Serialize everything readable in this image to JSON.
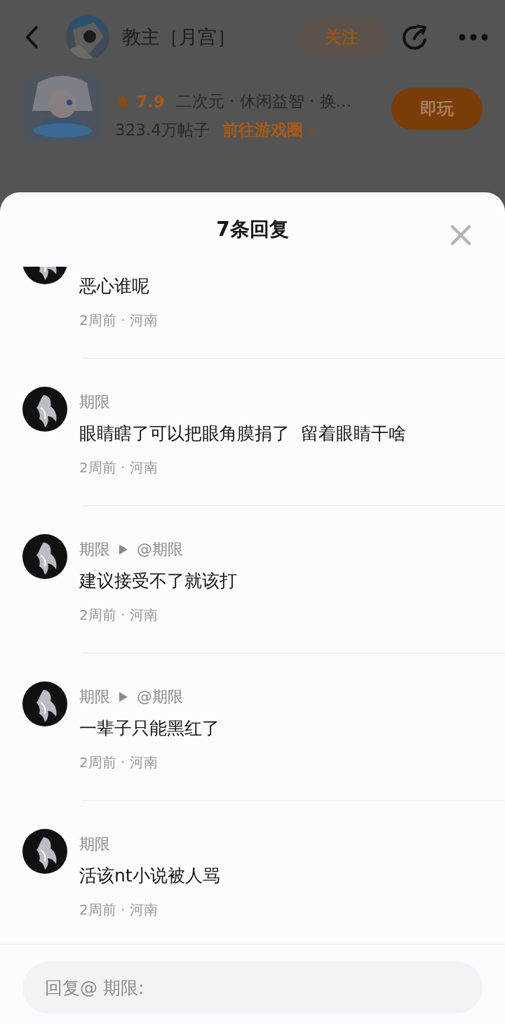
{
  "top_bar": {
    "title": "教主［月宫］",
    "follow_button": "关注"
  },
  "game": {
    "rating": "7.9",
    "tags": "二次元 · 休闲益智 · 换…",
    "posts": "323.4万帖子",
    "link": "前往游戏圈",
    "play_button": "即玩"
  },
  "sheet": {
    "title": "7条回复",
    "replies": [
      {
        "text": "恶心谁呢",
        "meta": "2周前 · 河南"
      },
      {
        "name": "期限",
        "text": "眼睛瞎了可以把眼角膜捐了  留着眼睛干啥",
        "meta": "2周前 · 河南"
      },
      {
        "name": "期限",
        "target": "@期限",
        "text": "建议接受不了就该打",
        "meta": "2周前 · 河南"
      },
      {
        "name": "期限",
        "target": "@期限",
        "text": "一辈子只能黑红了",
        "meta": "2周前 · 河南"
      },
      {
        "name": "期限",
        "text": "活该nt小说被人骂",
        "meta": "2周前 · 河南"
      }
    ]
  },
  "reply_input": {
    "placeholder": "回复@ 期限:"
  }
}
